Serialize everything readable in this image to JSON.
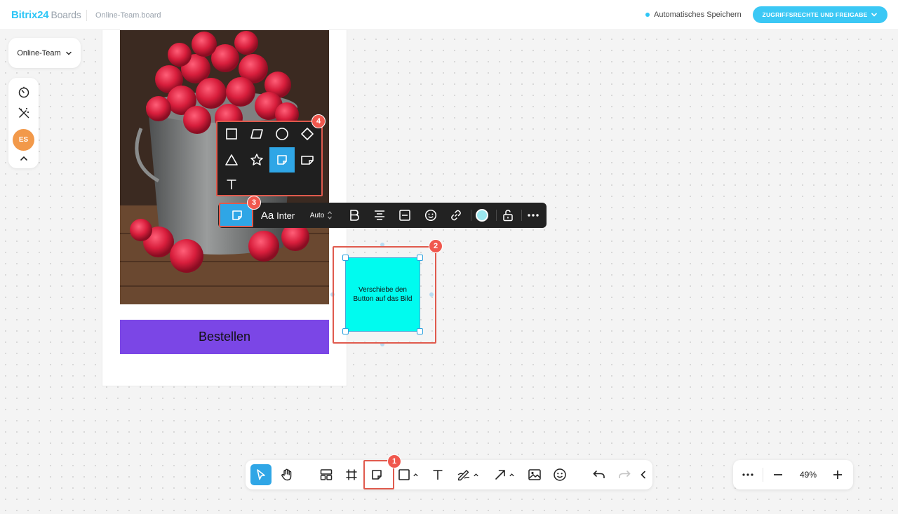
{
  "header": {
    "logo_main": "Bitrix",
    "logo_num": "24",
    "logo_product": "Boards",
    "board_name": "Online-Team.board",
    "autosave_label": "Automatisches Speichern",
    "share_button": "ZUGRIFFSRECHTE UND FREIGABE"
  },
  "left_panel": {
    "team_selector": "Online-Team",
    "avatar_initials": "ES"
  },
  "canvas": {
    "order_button": "Bestellen",
    "sticky_text": "Verschiebe den Button auf das Bild"
  },
  "context_toolbar": {
    "font_prefix": "Aa",
    "font_name": "Inter",
    "font_size": "Auto",
    "sticky_color": "#9be8f0"
  },
  "badges": {
    "b1": "1",
    "b2": "2",
    "b3": "3",
    "b4": "4"
  },
  "zoom": {
    "value": "49%"
  },
  "colors": {
    "accent": "#2fc6f6",
    "button_purple": "#7b46e6",
    "sticky": "#00fbef",
    "highlight": "#e05a4d"
  }
}
